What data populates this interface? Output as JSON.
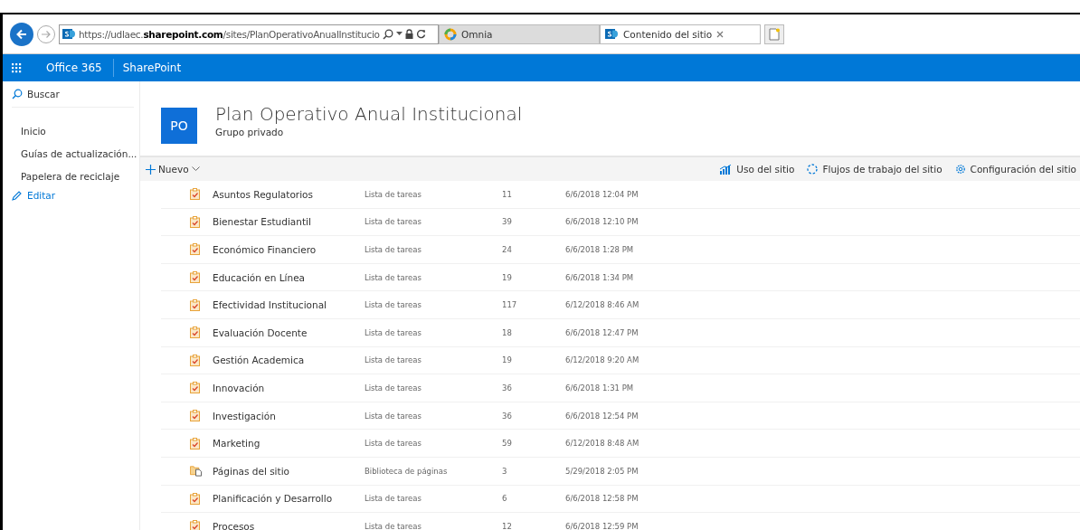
{
  "browser": {
    "address": {
      "prefix": "https://udlaec.",
      "host": "sharepoint.com",
      "path": "/sites/PlanOperativoAnualInstitucio"
    },
    "tabs": [
      {
        "label": "Omnia",
        "selected": false,
        "kind": "omnia"
      },
      {
        "label": "Contenido del sitio",
        "selected": true,
        "kind": "sharepoint"
      }
    ]
  },
  "suite_bar": {
    "app": "Office 365",
    "product": "SharePoint"
  },
  "sidebar": {
    "search": "Buscar",
    "items": [
      {
        "label": "Inicio"
      },
      {
        "label": "Guías de actualización..."
      },
      {
        "label": "Papelera de reciclaje"
      }
    ],
    "edit": "Editar"
  },
  "site": {
    "logo": "PO",
    "title": "Plan Operativo Anual Institucional",
    "subtitle": "Grupo privado"
  },
  "command_bar": {
    "new": "Nuevo",
    "actions": [
      {
        "label": "Uso del sitio",
        "kind": "usage"
      },
      {
        "label": "Flujos de trabajo del sitio",
        "kind": "workflow"
      },
      {
        "label": "Configuración del sitio",
        "kind": "settings"
      }
    ]
  },
  "rows": [
    {
      "name": "Asuntos Regulatorios",
      "type": "Lista de tareas",
      "items": "11",
      "modified": "6/6/2018 12:04 PM",
      "kind": "tasks"
    },
    {
      "name": "Bienestar Estudiantil",
      "type": "Lista de tareas",
      "items": "39",
      "modified": "6/6/2018 12:10 PM",
      "kind": "tasks"
    },
    {
      "name": "Económico Financiero",
      "type": "Lista de tareas",
      "items": "24",
      "modified": "6/6/2018 1:28 PM",
      "kind": "tasks"
    },
    {
      "name": "Educación en Línea",
      "type": "Lista de tareas",
      "items": "19",
      "modified": "6/6/2018 1:34 PM",
      "kind": "tasks"
    },
    {
      "name": "Efectividad Institucional",
      "type": "Lista de tareas",
      "items": "117",
      "modified": "6/12/2018 8:46 AM",
      "kind": "tasks"
    },
    {
      "name": "Evaluación Docente",
      "type": "Lista de tareas",
      "items": "18",
      "modified": "6/6/2018 12:47 PM",
      "kind": "tasks"
    },
    {
      "name": "Gestión Academica",
      "type": "Lista de tareas",
      "items": "19",
      "modified": "6/12/2018 9:20 AM",
      "kind": "tasks"
    },
    {
      "name": "Innovación",
      "type": "Lista de tareas",
      "items": "36",
      "modified": "6/6/2018 1:31 PM",
      "kind": "tasks"
    },
    {
      "name": "Investigación",
      "type": "Lista de tareas",
      "items": "36",
      "modified": "6/6/2018 12:54 PM",
      "kind": "tasks"
    },
    {
      "name": "Marketing",
      "type": "Lista de tareas",
      "items": "59",
      "modified": "6/12/2018 8:48 AM",
      "kind": "tasks"
    },
    {
      "name": "Páginas del sitio",
      "type": "Biblioteca de páginas",
      "items": "3",
      "modified": "5/29/2018 2:05 PM",
      "kind": "pages"
    },
    {
      "name": "Planificación y Desarrollo",
      "type": "Lista de tareas",
      "items": "6",
      "modified": "6/6/2018 12:58 PM",
      "kind": "tasks"
    },
    {
      "name": "Procesos",
      "type": "Lista de tareas",
      "items": "12",
      "modified": "6/6/2018 12:59 PM",
      "kind": "tasks"
    }
  ]
}
